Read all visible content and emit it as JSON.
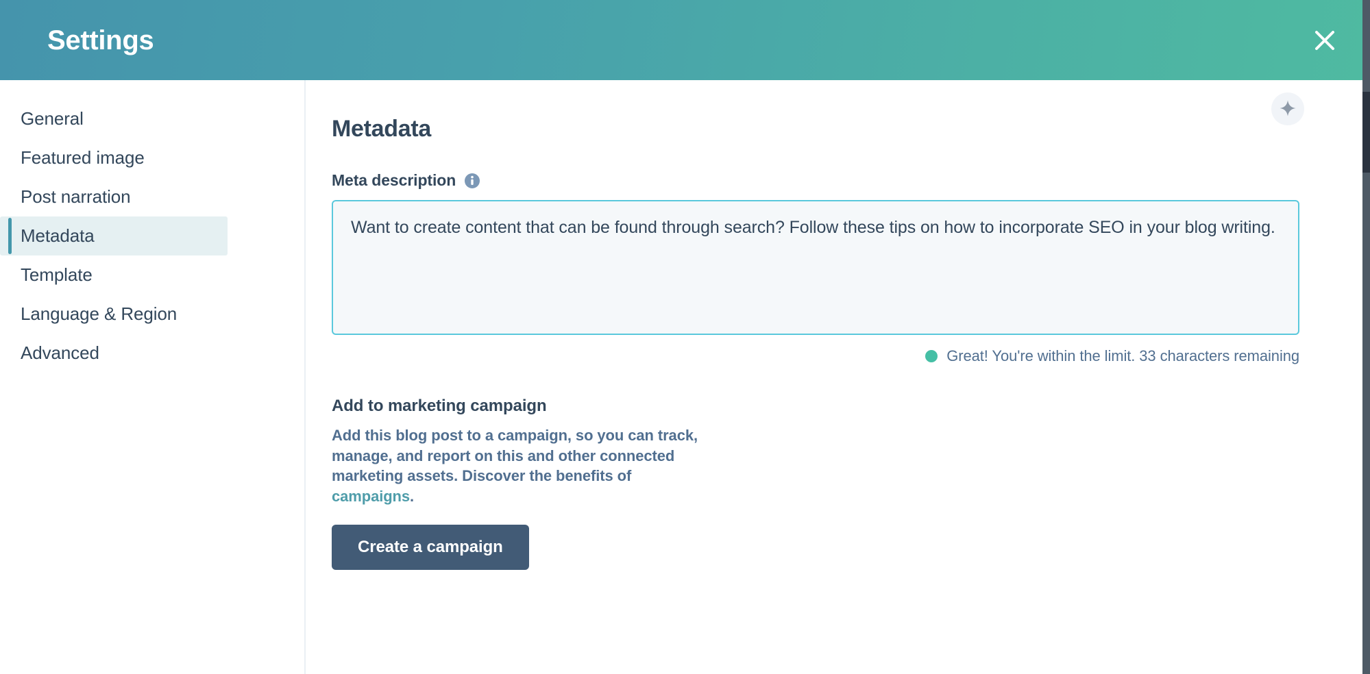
{
  "header": {
    "title": "Settings",
    "close_icon": "close-icon",
    "gradient_from": "#4594ac",
    "gradient_to": "#4fbaa1"
  },
  "sidebar": {
    "items": [
      {
        "label": "General",
        "active": false
      },
      {
        "label": "Featured image",
        "active": false
      },
      {
        "label": "Post narration",
        "active": false
      },
      {
        "label": "Metadata",
        "active": true
      },
      {
        "label": "Template",
        "active": false
      },
      {
        "label": "Language & Region",
        "active": false
      },
      {
        "label": "Advanced",
        "active": false
      }
    ],
    "active_accent": "#4397ab",
    "active_background": "#e5f0f2"
  },
  "main": {
    "section_title": "Metadata",
    "meta_description": {
      "label": "Meta description",
      "info_icon": "info-icon",
      "ai_icon": "ai-sparkle-icon",
      "value": "Want to create content that can be found through search? Follow these tips on how to incorporate SEO in your blog writing.",
      "placeholder": "Enter a meta description",
      "border_color": "#5ac8dc",
      "background_color": "#f5f8fa"
    },
    "char_counter": {
      "text": "Great! You're within the limit. 33 characters remaining",
      "dot_color": "#45bfa5",
      "remaining": 33,
      "status": "within-limit"
    },
    "campaign": {
      "title": "Add to marketing campaign",
      "description_part1": "Add this blog post to a campaign, so you can track, manage, and report on this and other connected marketing assets. Discover the benefits of ",
      "link_text": "campaigns",
      "description_part2": ".",
      "link_color": "#4f9daa",
      "button_label": "Create a campaign",
      "button_color": "#425b76"
    }
  }
}
